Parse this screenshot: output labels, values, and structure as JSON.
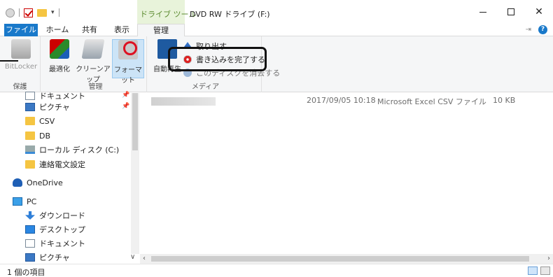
{
  "titlebar": {
    "context_label": "ドライブ ツール",
    "window_title": "DVD RW ドライブ (F:)",
    "minimize": "–",
    "maximize": "□",
    "close": "✕",
    "dropdown": "▾"
  },
  "tabs": {
    "file": "ファイル",
    "home": "ホーム",
    "share": "共有",
    "view": "表示",
    "manage": "管理"
  },
  "ribbon": {
    "groups": {
      "protect": "保護",
      "manage": "管理",
      "media": "メディア"
    },
    "buttons": {
      "bitlocker": "BitLocker",
      "optimize": "最適化",
      "cleanup": "クリーンアップ",
      "format": "フォーマット",
      "autoplay": "自動再生"
    },
    "small_commands": {
      "eject": "取り出す",
      "finish_burning": "書き込みを完了する",
      "erase_disc": "このディスクを消去する"
    },
    "pin_label": "⇥",
    "help_label": "?"
  },
  "nav": {
    "items": [
      {
        "label": "ドキュメント",
        "icon": "document-icon"
      },
      {
        "label": "ピクチャ",
        "icon": "pictures-icon"
      },
      {
        "label": "CSV",
        "icon": "folder-icon"
      },
      {
        "label": "DB",
        "icon": "folder-icon"
      },
      {
        "label": "ローカル ディスク (C:)",
        "icon": "drive-icon"
      },
      {
        "label": "連絡電文設定",
        "icon": "folder-icon"
      },
      {
        "label": "OneDrive",
        "icon": "cloud-icon"
      },
      {
        "label": "PC",
        "icon": "pc-icon"
      },
      {
        "label": "ダウンロード",
        "icon": "download-icon"
      },
      {
        "label": "デスクトップ",
        "icon": "desktop-icon"
      },
      {
        "label": "ドキュメント",
        "icon": "document-icon"
      },
      {
        "label": "ピクチャ",
        "icon": "pictures-icon"
      }
    ]
  },
  "files": [
    {
      "date": "2017/09/05 10:18",
      "type": "Microsoft Excel CSV ファイル",
      "size": "10 KB"
    }
  ],
  "status": {
    "item_count": "1 個の項目"
  },
  "colors": {
    "accent": "#1979ca",
    "context_tab": "#e8f3da"
  }
}
